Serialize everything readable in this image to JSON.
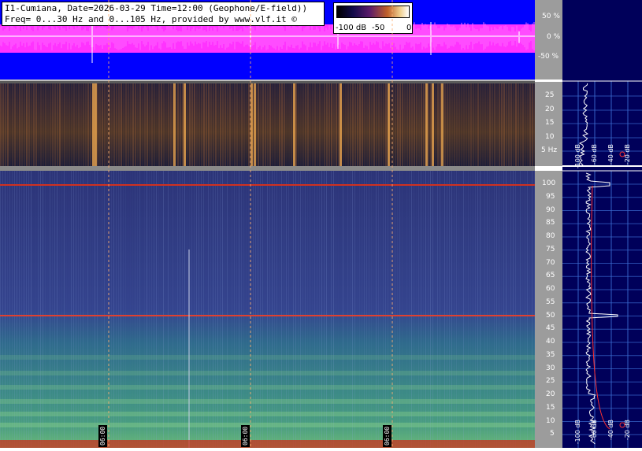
{
  "header": {
    "line1": "I1-Cumiana, Date=2026-03-29 Time=12:00 (Geophone/E-field))",
    "line2": "Freq= 0...30 Hz and 0...105 Hz, provided by www.vlf.it ©"
  },
  "scale": {
    "left": "-100 dB",
    "mid": "-50",
    "right": "0"
  },
  "wave_axis": [
    "50 %",
    "0 %",
    "-50 %"
  ],
  "top_axis": [
    "25",
    "20",
    "15",
    "10",
    "5 Hz"
  ],
  "main_axis": [
    "100",
    "95",
    "90",
    "85",
    "80",
    "75",
    "70",
    "65",
    "60",
    "55",
    "50",
    "45",
    "40",
    "35",
    "30",
    "25",
    "20",
    "15",
    "10",
    "5"
  ],
  "time_markers": [
    "06:00",
    "06:00",
    "06:00"
  ],
  "right_panel_labels_top": [
    "-100 dB",
    "-60 dB",
    "-40 dB",
    "-20 dB"
  ],
  "right_panel_labels_bottom": [
    "-100 dB",
    "-60 dB",
    "-40 dB",
    "-20 dB"
  ],
  "colors": {
    "waveform": "#ff33ff",
    "wave_bg": "#0000ff",
    "axis_bg": "#9c9c9c",
    "right_bg": "#00005a",
    "spectrum_line": "#ffffff",
    "fit_line": "#ff2020"
  }
}
